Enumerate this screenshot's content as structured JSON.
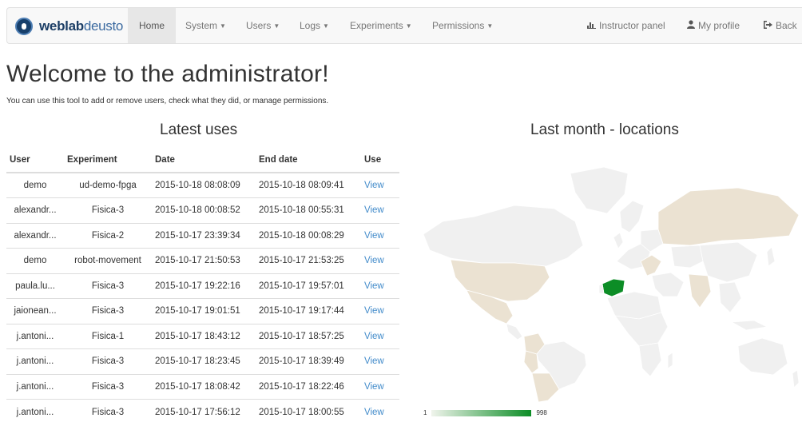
{
  "brand": {
    "strong": "weblab",
    "light": "deusto"
  },
  "nav": {
    "home": "Home",
    "system": "System",
    "users": "Users",
    "logs": "Logs",
    "experiments": "Experiments",
    "permissions": "Permissions",
    "instructor_panel": "Instructor panel",
    "my_profile": "My profile",
    "back": "Back"
  },
  "page": {
    "title": "Welcome to the administrator!",
    "intro": "You can use this tool to add or remove users, check what they did, or manage permissions."
  },
  "latest_uses": {
    "title": "Latest uses",
    "columns": [
      "User",
      "Experiment",
      "Date",
      "End date",
      "Use"
    ],
    "rows": [
      [
        "demo",
        "ud-demo-fpga",
        "2015-10-18 08:08:09",
        "2015-10-18 08:09:41",
        "View"
      ],
      [
        "alexandr...",
        "Fisica-3",
        "2015-10-18 00:08:52",
        "2015-10-18 00:55:31",
        "View"
      ],
      [
        "alexandr...",
        "Fisica-2",
        "2015-10-17 23:39:34",
        "2015-10-18 00:08:29",
        "View"
      ],
      [
        "demo",
        "robot-movement",
        "2015-10-17 21:50:53",
        "2015-10-17 21:53:25",
        "View"
      ],
      [
        "paula.lu...",
        "Fisica-3",
        "2015-10-17 19:22:16",
        "2015-10-17 19:57:01",
        "View"
      ],
      [
        "jaionean...",
        "Fisica-3",
        "2015-10-17 19:01:51",
        "2015-10-17 19:17:44",
        "View"
      ],
      [
        "j.antoni...",
        "Fisica-1",
        "2015-10-17 18:43:12",
        "2015-10-17 18:57:25",
        "View"
      ],
      [
        "j.antoni...",
        "Fisica-3",
        "2015-10-17 18:23:45",
        "2015-10-17 18:39:49",
        "View"
      ],
      [
        "j.antoni...",
        "Fisica-3",
        "2015-10-17 18:08:42",
        "2015-10-17 18:22:46",
        "View"
      ],
      [
        "j.antoni...",
        "Fisica-3",
        "2015-10-17 17:56:12",
        "2015-10-17 18:00:55",
        "View"
      ]
    ]
  },
  "map": {
    "title": "Last month - locations",
    "legend_min": "1",
    "legend_max": "998",
    "colors": {
      "none": "#f0f0f0",
      "low": "#ebe2d2",
      "high": "#0c8d26",
      "border": "#ffffff"
    }
  },
  "icons": {
    "instructor": "bar-chart-icon",
    "profile": "user-icon",
    "back": "sign-out-icon"
  }
}
